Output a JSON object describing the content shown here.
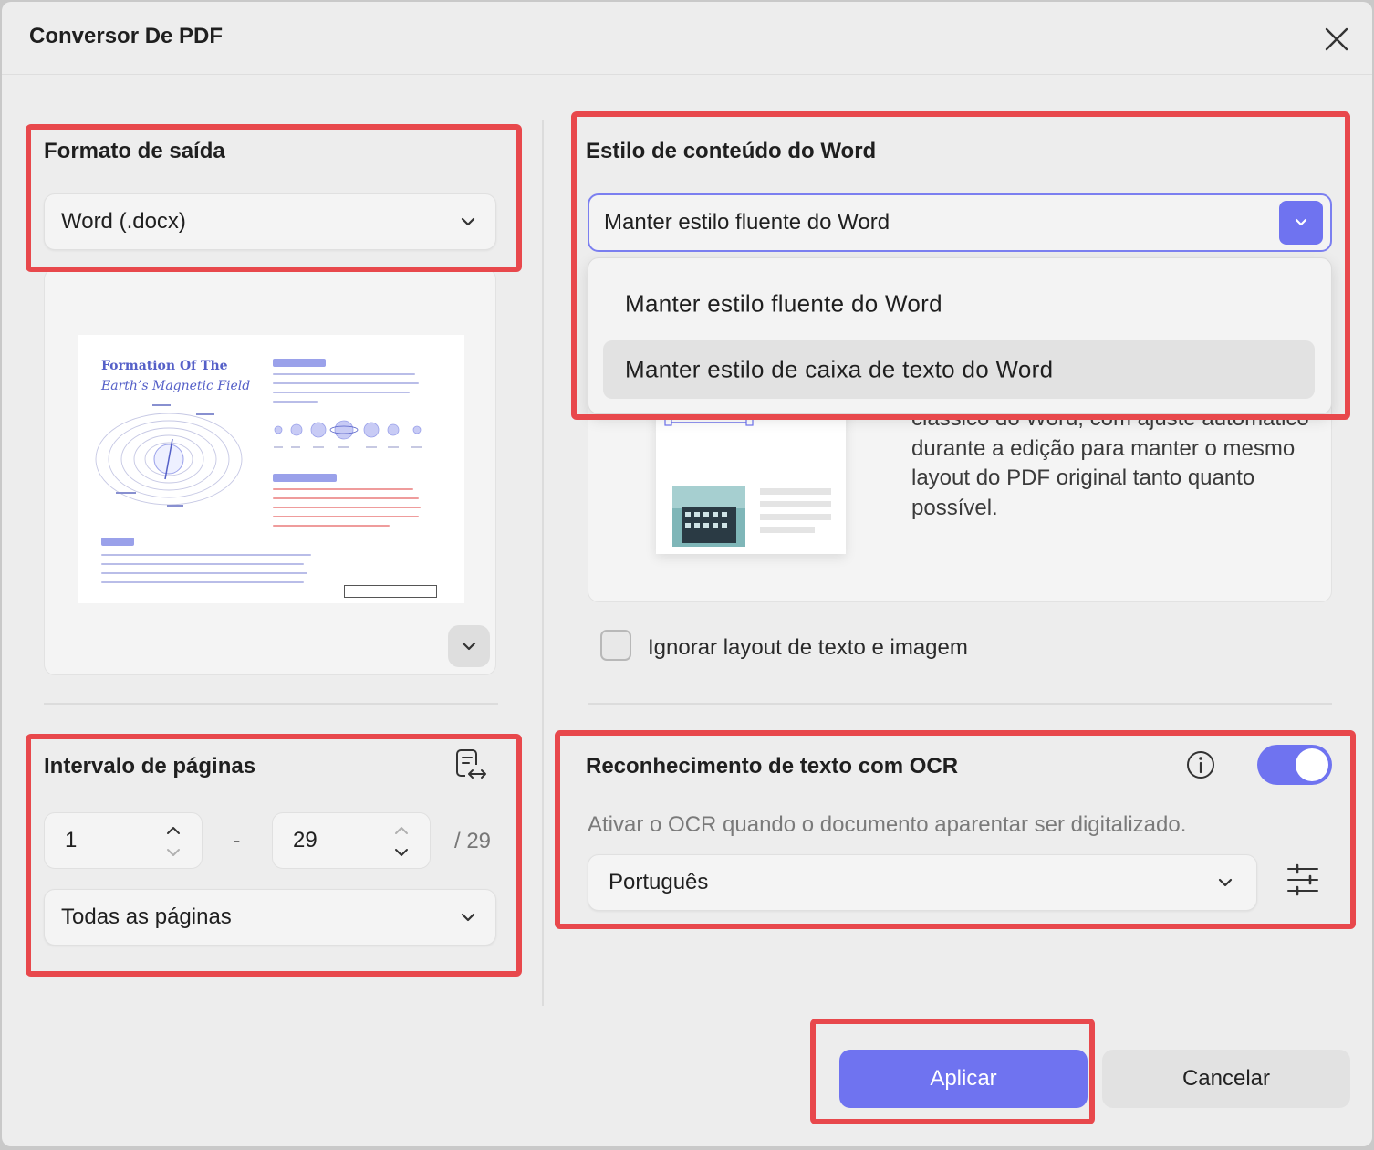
{
  "window": {
    "title": "Conversor De PDF"
  },
  "output_format": {
    "label": "Formato de saída",
    "value": "Word (.docx)"
  },
  "preview": {
    "doc_title_line1": "Formation Of The",
    "doc_title_line2": "Earth’s Magnetic Field"
  },
  "page_range": {
    "label": "Intervalo de páginas",
    "from": "1",
    "to": "29",
    "separator": "-",
    "total": "/ 29",
    "selection": "Todas as páginas"
  },
  "word_style": {
    "label": "Estilo de conteúdo do Word",
    "selected": "Manter estilo fluente do Word",
    "options": [
      "Manter estilo fluente do Word",
      "Manter estilo de caixa de texto do Word"
    ],
    "hovered_option_index": 1,
    "description": "clássico do Word, com ajuste automático durante a edição para manter o mesmo layout do PDF original tanto quanto possível."
  },
  "ignore_layout": {
    "label": "Ignorar layout de texto e imagem",
    "checked": false
  },
  "ocr": {
    "label": "Reconhecimento de texto com OCR",
    "enabled": true,
    "description": "Ativar o OCR quando o documento aparentar ser digitalizado.",
    "language": "Português"
  },
  "buttons": {
    "apply": "Aplicar",
    "cancel": "Cancelar"
  },
  "colors": {
    "accent": "#6F73F0",
    "highlight": "#E8484C",
    "background": "#EDEDED"
  }
}
